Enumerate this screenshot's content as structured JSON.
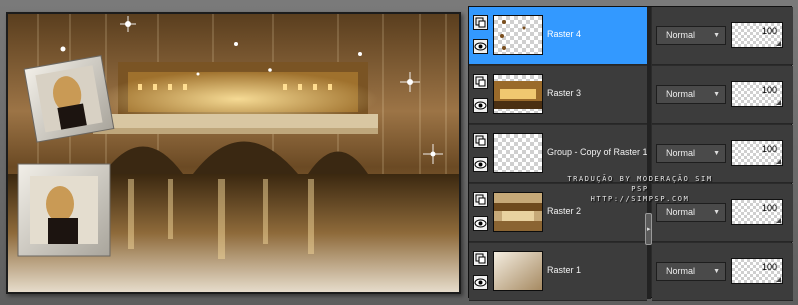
{
  "canvas": {
    "description_icon": "image-preview"
  },
  "layers": [
    {
      "name": "Raster 4",
      "selected": true,
      "icon": "transparent-with-sparkles",
      "blend": "Normal",
      "opacity": "100"
    },
    {
      "name": "Raster 3",
      "selected": false,
      "icon": "golden-scene",
      "blend": "Normal",
      "opacity": "100"
    },
    {
      "name": "Group - Copy of Raster 1",
      "selected": false,
      "icon": "transparent",
      "blend": "Normal",
      "opacity": "100"
    },
    {
      "name": "Raster 2",
      "selected": false,
      "icon": "golden-strip",
      "blend": "Normal",
      "opacity": "100"
    },
    {
      "name": "Raster 1",
      "selected": false,
      "icon": "beige-gradient",
      "blend": "Normal",
      "opacity": "100"
    }
  ],
  "dropdown_arrow": "▼",
  "splitter_arrow": "▸",
  "watermark": {
    "line1": "TRADUÇÃO BY MODERAÇÃO SIM PSP",
    "line2": "HTTP://SIMPSP.COM"
  },
  "colors": {
    "selected": "#3399ff",
    "row": "#3c3c3c",
    "panel": "#2b2b2b"
  }
}
